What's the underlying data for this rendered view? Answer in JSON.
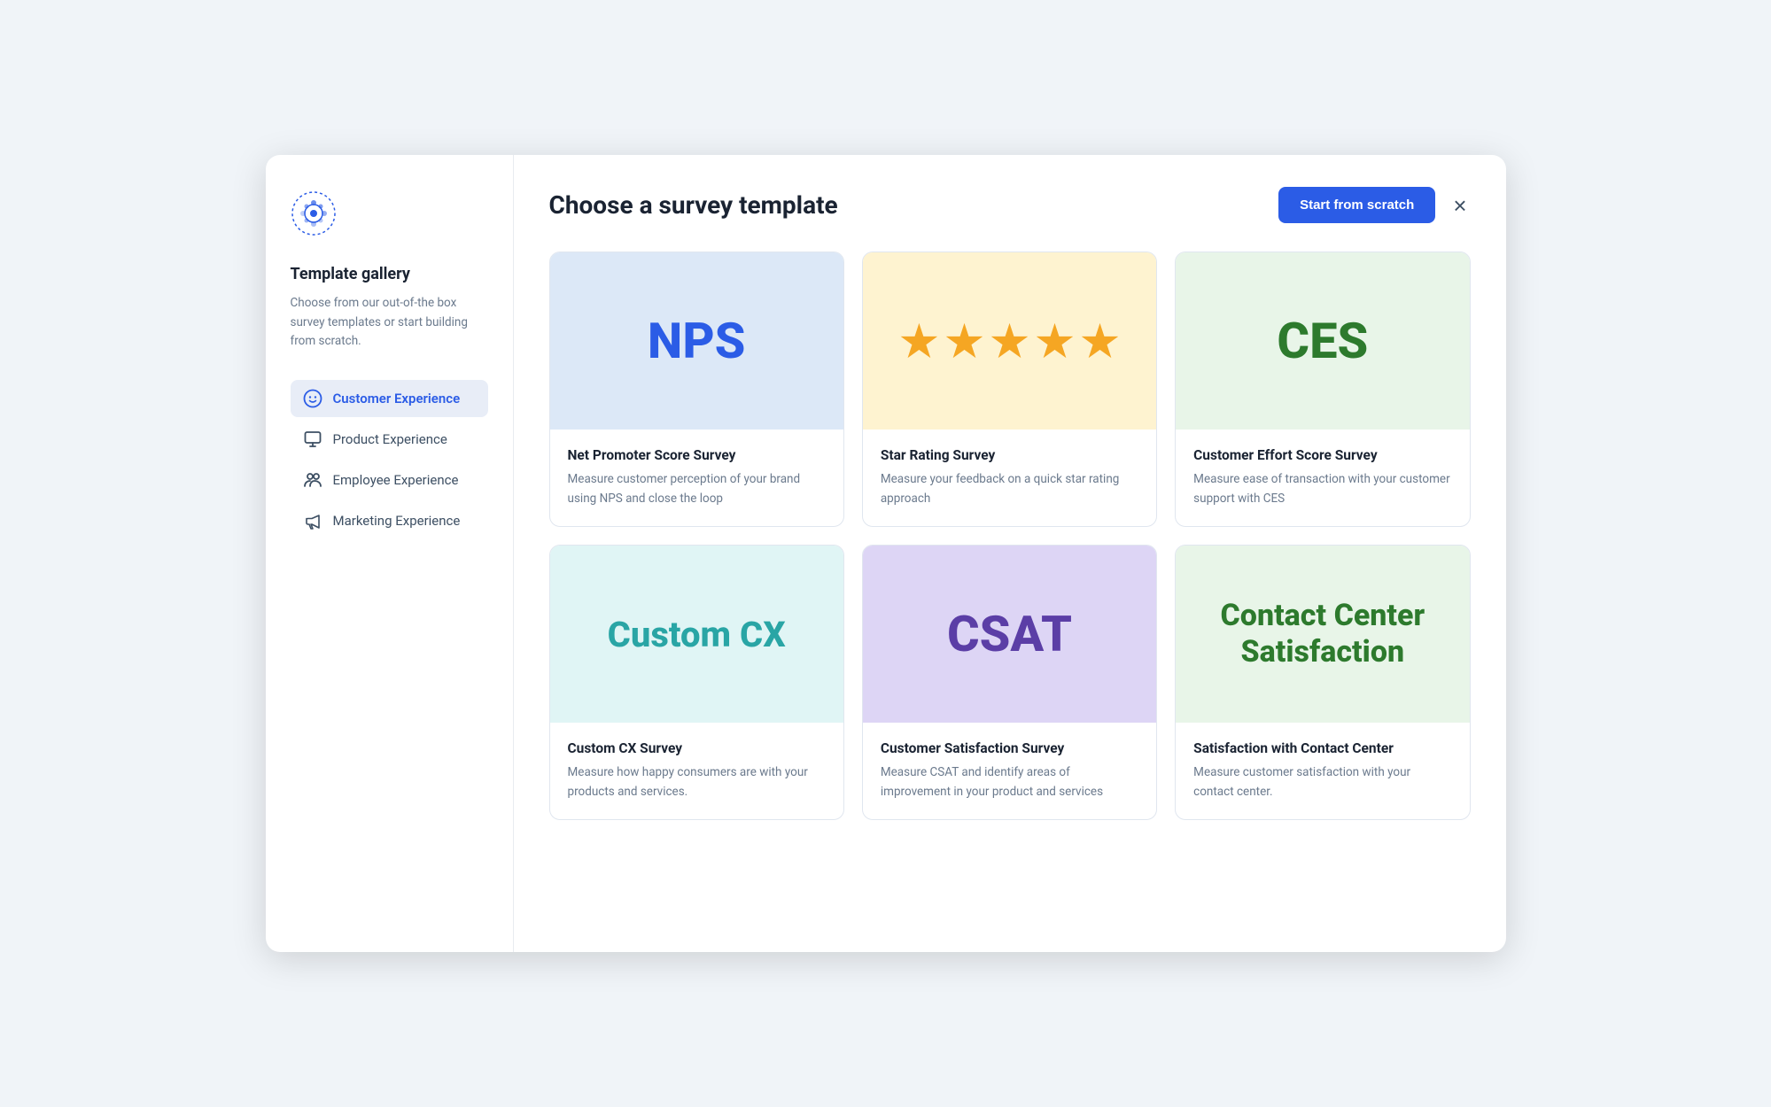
{
  "sidebar": {
    "title": "Template gallery",
    "description": "Choose from our out-of-the box survey templates or start building from scratch.",
    "nav_items": [
      {
        "id": "customer-experience",
        "label": "Customer Experience",
        "active": true,
        "icon": "smiley"
      },
      {
        "id": "product-experience",
        "label": "Product Experience",
        "active": false,
        "icon": "monitor"
      },
      {
        "id": "employee-experience",
        "label": "Employee Experience",
        "active": false,
        "icon": "people"
      },
      {
        "id": "marketing-experience",
        "label": "Marketing Experience",
        "active": false,
        "icon": "megaphone"
      }
    ]
  },
  "header": {
    "title": "Choose a survey template",
    "start_from_scratch": "Start from scratch",
    "close_label": "×"
  },
  "templates": [
    {
      "id": "nps",
      "visual_text": "NPS",
      "visual_class": "nps-bg nps-text",
      "is_stars": false,
      "name": "Net Promoter Score Survey",
      "description": "Measure customer perception of your brand using NPS and close the loop"
    },
    {
      "id": "star-rating",
      "visual_text": "★ ★ ★ ★ ★",
      "visual_class": "star-bg",
      "is_stars": true,
      "name": "Star Rating Survey",
      "description": "Measure your feedback on a quick star rating approach"
    },
    {
      "id": "ces",
      "visual_text": "CES",
      "visual_class": "ces-bg ces-text",
      "is_stars": false,
      "name": "Customer Effort Score Survey",
      "description": "Measure ease of transaction with your customer support with CES"
    },
    {
      "id": "custom-cx",
      "visual_text": "Custom CX",
      "visual_class": "custom-bg custom-text",
      "is_stars": false,
      "name": "Custom CX Survey",
      "description": "Measure how happy consumers are with your products and services."
    },
    {
      "id": "csat",
      "visual_text": "CSAT",
      "visual_class": "csat-bg csat-text",
      "is_stars": false,
      "name": "Customer Satisfaction Survey",
      "description": "Measure CSAT and identify areas of improvement in your product and services"
    },
    {
      "id": "contact-center",
      "visual_text": "Contact Center Satisfaction",
      "visual_class": "contact-bg contact-text",
      "is_stars": false,
      "name": "Satisfaction with Contact Center",
      "description": "Measure customer satisfaction with your contact center."
    }
  ]
}
